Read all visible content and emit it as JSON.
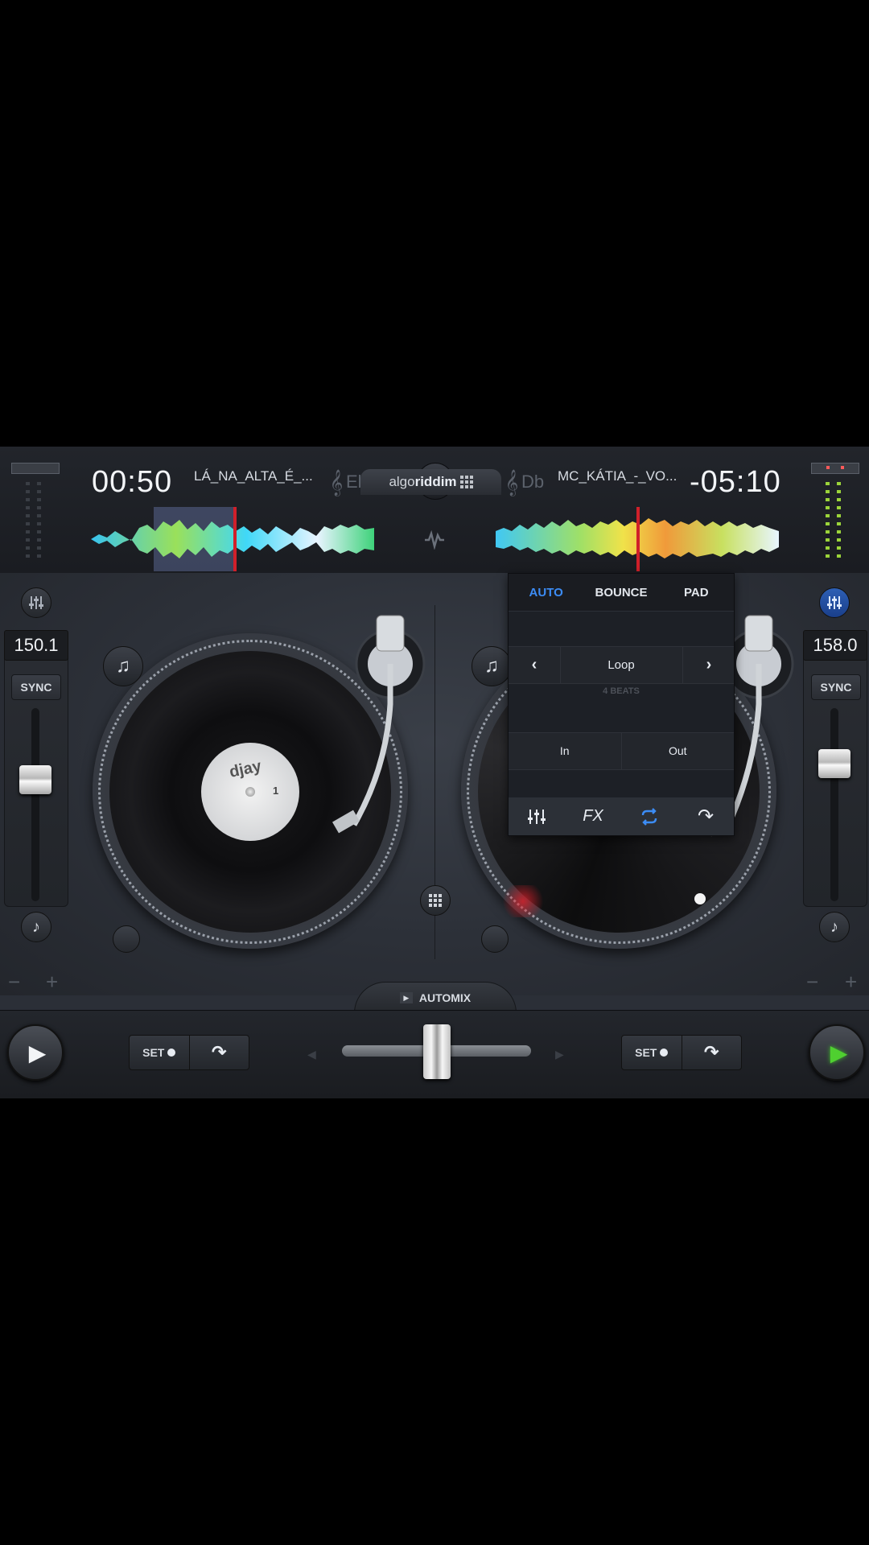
{
  "deck_left": {
    "time": "00:50",
    "track": "LÁ_NA_ALTA_É_...",
    "key": "Eb",
    "bpm": "150.1",
    "sync_label": "SYNC",
    "pitch_level": 0.35,
    "set_label": "SET",
    "minus": "−",
    "plus": "+"
  },
  "deck_right": {
    "time": "-05:10",
    "track": "MC_KÁTIA_-_VO...",
    "key": "Db",
    "bpm": "158.0",
    "sync_label": "SYNC",
    "pitch_level": 0.25,
    "set_label": "SET",
    "minus": "−",
    "plus": "+"
  },
  "brand": {
    "logo_text_light": "algo",
    "logo_text_bold": "riddim",
    "label_text": "djay",
    "label_number": "1"
  },
  "loop_popup": {
    "tabs": [
      "AUTO",
      "BOUNCE",
      "PAD"
    ],
    "active_tab": "AUTO",
    "loop_label": "Loop",
    "beats_label": "4 BEATS",
    "in_label": "In",
    "out_label": "Out",
    "fx_label": "FX",
    "prev_icon": "chevron-left-icon",
    "next_icon": "chevron-right-icon"
  },
  "automix_label": "AUTOMIX",
  "crossfader_level": 0.5,
  "colors": {
    "accent_blue": "#3c8cf5",
    "record_red": "#c0141c",
    "play_green": "#3fbf2a",
    "meter_green": "#9bd43a"
  }
}
